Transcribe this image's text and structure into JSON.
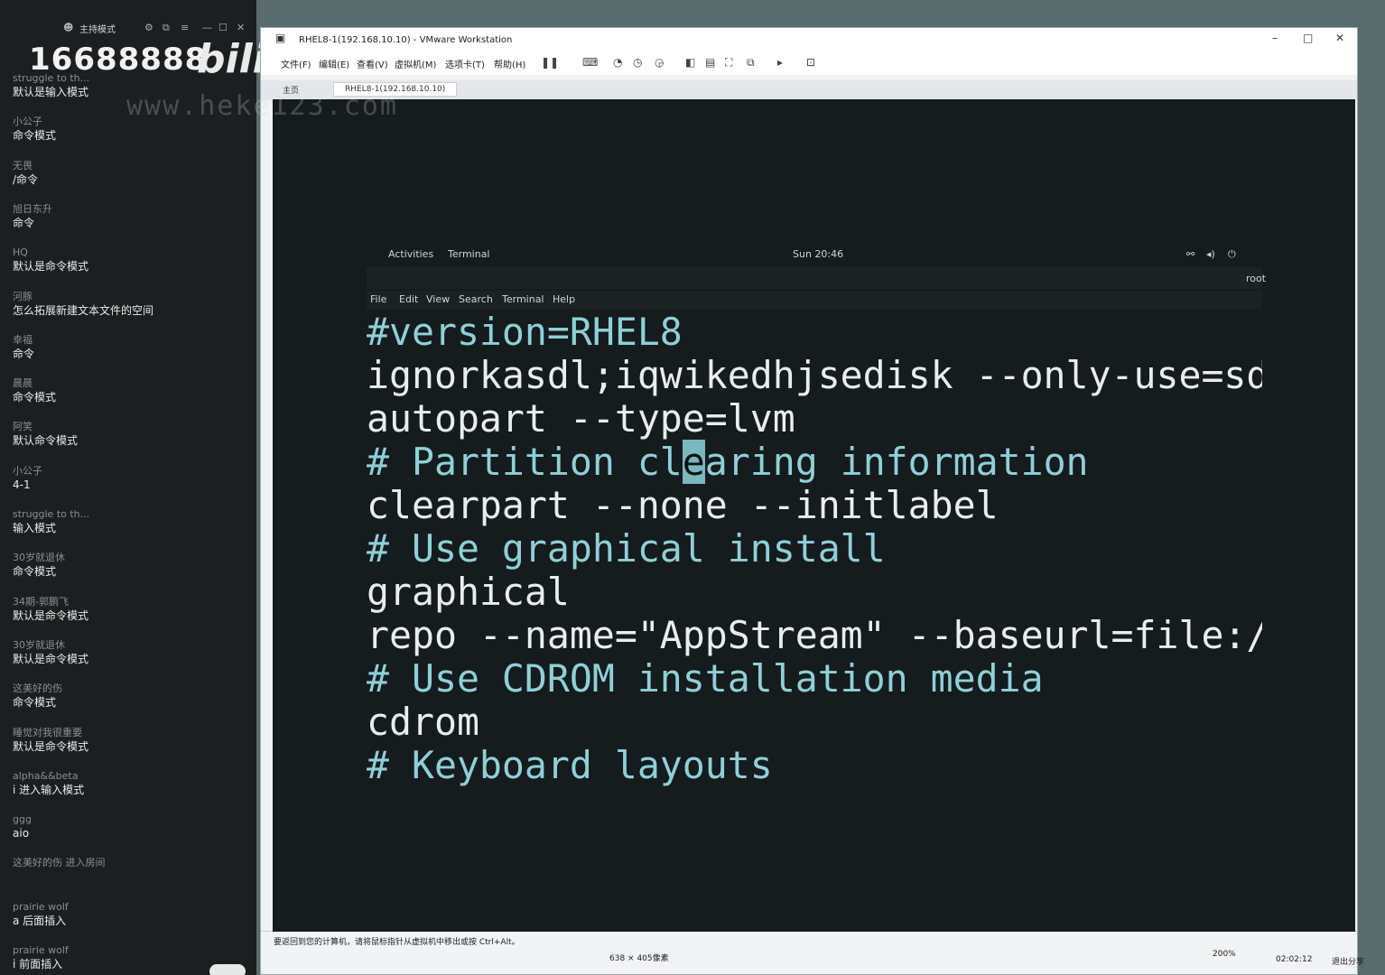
{
  "chat": {
    "top": {
      "mode_label": "主持模式"
    },
    "stream_id": "16688888",
    "logo": "bili",
    "watermark": "www.heke123.com",
    "messages": [
      {
        "user": "struggle to th...",
        "text": "默认是输入模式"
      },
      {
        "user": "小公子",
        "text": "命令模式"
      },
      {
        "user": "无畏",
        "text": "/命令"
      },
      {
        "user": "旭日东升",
        "text": "命令"
      },
      {
        "user": "HQ",
        "text": "默认是命令模式"
      },
      {
        "user": "河豚",
        "text": "怎么拓展新建文本文件的空间"
      },
      {
        "user": "幸福",
        "text": "命令"
      },
      {
        "user": "晨晨",
        "text": "命令模式"
      },
      {
        "user": "阿笑",
        "text": "默认命令模式"
      },
      {
        "user": "小公子",
        "text": "4-1"
      },
      {
        "user": "struggle to th...",
        "text": "输入模式"
      },
      {
        "user": "30岁就退休",
        "text": "命令模式"
      },
      {
        "user": "34期-郭鹏飞",
        "text": "默认是命令模式"
      },
      {
        "user": "30岁就退休",
        "text": "默认是命令模式"
      },
      {
        "user": "这美好的伤",
        "text": "命令模式"
      },
      {
        "user": "睡觉对我很重要",
        "text": "默认是命令模式"
      },
      {
        "user": "alpha&&beta",
        "text": "i 进入输入模式"
      },
      {
        "user": "ggg",
        "text": "aio"
      },
      {
        "user": "这美好的伤 进入房间",
        "text": ""
      },
      {
        "user": "prairie wolf",
        "text": "a  后面插入"
      },
      {
        "user": "prairie wolf",
        "text": "i  前面插入"
      }
    ]
  },
  "vmware": {
    "title": "RHEL8-1(192.168.10.10) - VMware Workstation",
    "menu": [
      "文件(F)",
      "编辑(E)",
      "查看(V)",
      "虚拟机(M)",
      "选项卡(T)",
      "帮助(H)"
    ],
    "tabs": {
      "home": "主页",
      "vm": "RHEL8-1(192.168.10.10)"
    },
    "status": {
      "hint": "要返回到您的计算机，请将鼠标指针从虚拟机中移出或按 Ctrl+Alt。",
      "resolution": "638 × 405像素",
      "zoom": "200%",
      "time": "02:02:12",
      "exit_share": "退出分享"
    }
  },
  "gnome": {
    "activities": "Activities",
    "app": "Terminal",
    "clock": "Sun 20:46",
    "user_fragment": "root"
  },
  "terminal": {
    "menu": [
      "File",
      "Edit",
      "View",
      "Search",
      "Terminal",
      "Help"
    ],
    "lines": [
      "#version=RHEL8",
      "ignorkasdl;iqwikedhjsedisk --only-use=sd",
      "autopart --type=lvm",
      "# Partition clearing information",
      "clearpart --none --initlabel",
      "# Use graphical install",
      "graphical",
      "repo --name=\"AppStream\" --baseurl=file:/",
      "# Use CDROM installation media",
      "cdrom",
      "# Keyboard layouts"
    ]
  }
}
